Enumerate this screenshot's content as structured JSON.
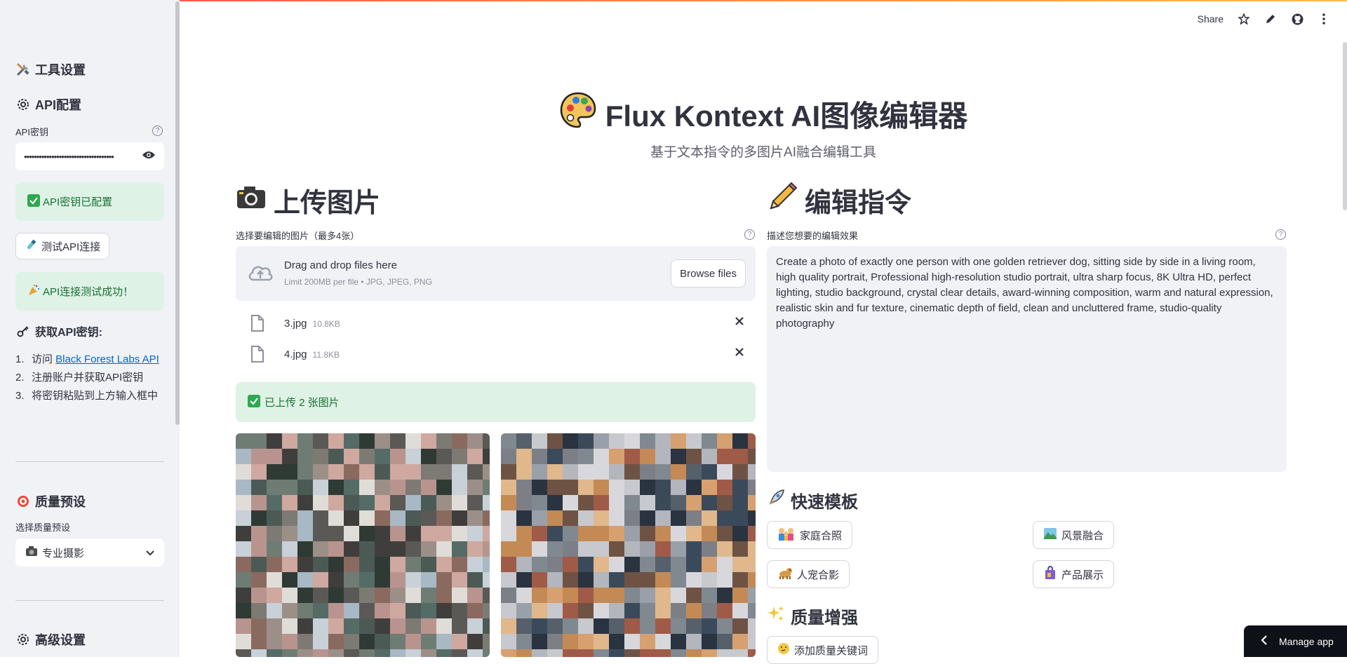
{
  "header": {
    "share_label": "Share",
    "icons": [
      "star-icon",
      "pencil-icon",
      "github-icon",
      "more-vertical-icon"
    ]
  },
  "sidebar": {
    "tool_settings_title": "工具设置",
    "api_config_title": "API配置",
    "api_key_label": "API密钥",
    "api_key_value": "••••••••••••••••••••••••••••••••••••",
    "api_key_status": "API密钥已配置",
    "test_button_label": "测试API连接",
    "test_success": "API连接测试成功！",
    "get_key_title": "获取API密钥:",
    "steps": [
      {
        "num": "1.",
        "prefix": "访问 ",
        "link": "Black Forest Labs API"
      },
      {
        "num": "2.",
        "text": "注册账户并获取API密钥"
      },
      {
        "num": "3.",
        "text": "将密钥粘贴到上方输入框中"
      }
    ],
    "quality_preset_title": "质量预设",
    "quality_preset_label": "选择质量预设",
    "quality_preset_value": "专业摄影",
    "advanced_title": "高级设置"
  },
  "main": {
    "title": "Flux Kontext AI图像编辑器",
    "subtitle": "基于文本指令的多图片AI融合编辑工具",
    "upload": {
      "heading": "上传图片",
      "label": "选择要编辑的图片（最多4张）",
      "drop_text": "Drag and drop files here",
      "limit_text": "Limit 200MB per file • JPG, JPEG, PNG",
      "browse_label": "Browse files",
      "files": [
        {
          "name": "3.jpg",
          "size": "10.8KB"
        },
        {
          "name": "4.jpg",
          "size": "11.8KB"
        }
      ],
      "success_text": "已上传 2 张图片"
    },
    "edit": {
      "heading": "编辑指令",
      "label": "描述您想要的编辑效果",
      "prompt": "Create a photo of exactly one person with one golden retriever dog, sitting side by side in a living room, high quality portrait, Professional high-resolution studio portrait, ultra sharp focus, 8K Ultra HD, perfect lighting, studio background, crystal clear details, award-winning composition, warm and natural expression, realistic skin and fur texture, cinematic depth of field, clean and uncluttered frame, studio-quality photography"
    },
    "quick_templates": {
      "heading": "快速模板",
      "buttons": [
        "家庭合照",
        "风景融合",
        "人宠合影",
        "产品展示"
      ]
    },
    "quality_boost": {
      "heading": "质量增强",
      "add_keywords_label": "添加质量关键词"
    }
  },
  "manage_app_label": "Manage app",
  "colors": {
    "accent": "#ff4b4b",
    "success_bg": "#dff2e6",
    "success_text": "#177233",
    "link": "#0068c9",
    "sidebar_bg": "#f0f2f6"
  }
}
